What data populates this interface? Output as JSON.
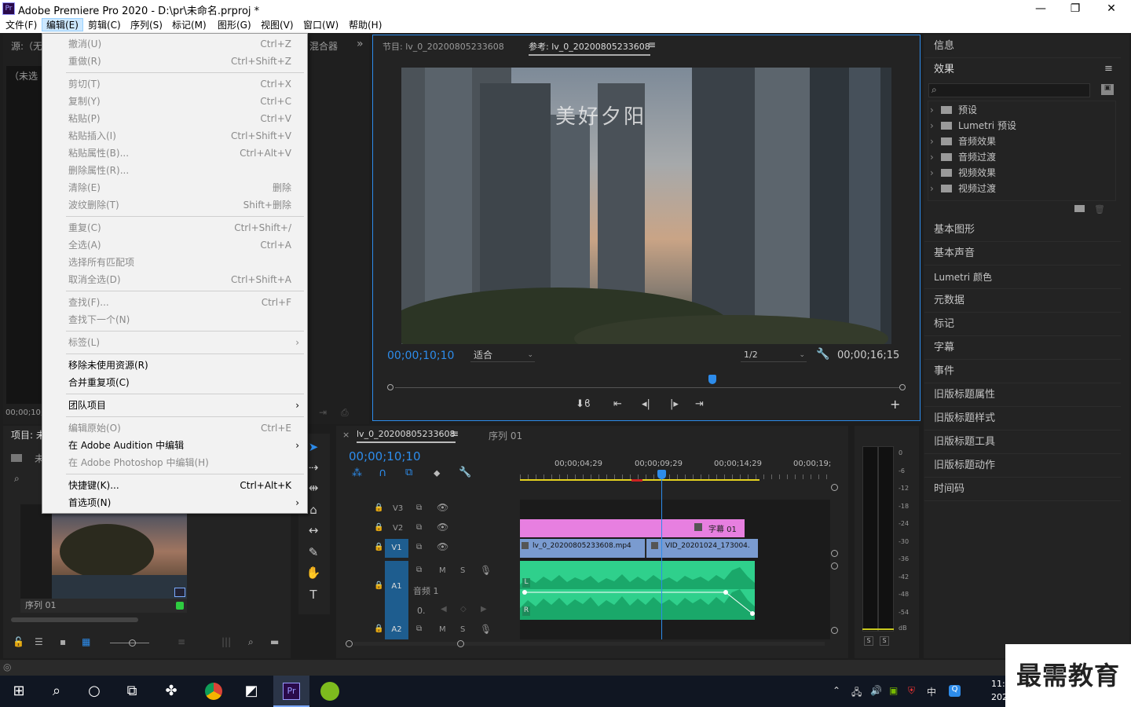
{
  "title_bar": {
    "app_icon": "Pr",
    "title": "Adobe Premiere Pro 2020 - D:\\pr\\未命名.prproj *",
    "minimize": "—",
    "maximize": "❐",
    "close": "✕"
  },
  "menu_bar": {
    "items": [
      "文件(F)",
      "编辑(E)",
      "剪辑(C)",
      "序列(S)",
      "标记(M)",
      "图形(G)",
      "视图(V)",
      "窗口(W)",
      "帮助(H)"
    ],
    "active_item": "编辑(E)"
  },
  "edit_menu": {
    "items": [
      {
        "label": "撤消(U)",
        "shortcut": "Ctrl+Z",
        "disabled": true
      },
      {
        "label": "重做(R)",
        "shortcut": "Ctrl+Shift+Z",
        "disabled": true
      },
      {
        "label": "剪切(T)",
        "shortcut": "Ctrl+X",
        "disabled": true
      },
      {
        "label": "复制(Y)",
        "shortcut": "Ctrl+C",
        "disabled": true
      },
      {
        "label": "粘贴(P)",
        "shortcut": "Ctrl+V",
        "disabled": true
      },
      {
        "label": "粘贴插入(I)",
        "shortcut": "Ctrl+Shift+V",
        "disabled": true
      },
      {
        "label": "粘贴属性(B)...",
        "shortcut": "Ctrl+Alt+V",
        "disabled": true
      },
      {
        "label": "删除属性(R)...",
        "shortcut": "",
        "disabled": true
      },
      {
        "label": "清除(E)",
        "shortcut": "删除",
        "disabled": true
      },
      {
        "label": "波纹删除(T)",
        "shortcut": "Shift+删除",
        "disabled": true
      },
      {
        "label": "重复(C)",
        "shortcut": "Ctrl+Shift+/",
        "disabled": true
      },
      {
        "label": "全选(A)",
        "shortcut": "Ctrl+A",
        "disabled": true
      },
      {
        "label": "选择所有匹配项",
        "shortcut": "",
        "disabled": true
      },
      {
        "label": "取消全选(D)",
        "shortcut": "Ctrl+Shift+A",
        "disabled": true
      },
      {
        "label": "查找(F)...",
        "shortcut": "Ctrl+F",
        "disabled": true
      },
      {
        "label": "查找下一个(N)",
        "shortcut": "",
        "disabled": true
      },
      {
        "label": "标签(L)",
        "shortcut": "",
        "disabled": true,
        "submenu": true
      },
      {
        "label": "移除未使用资源(R)",
        "shortcut": "",
        "disabled": false
      },
      {
        "label": "合并重复项(C)",
        "shortcut": "",
        "disabled": false
      },
      {
        "label": "团队项目",
        "shortcut": "",
        "disabled": false,
        "submenu": true
      },
      {
        "label": "编辑原始(O)",
        "shortcut": "Ctrl+E",
        "disabled": true
      },
      {
        "label": "在 Adobe Audition 中编辑",
        "shortcut": "",
        "disabled": false,
        "submenu": true
      },
      {
        "label": "在 Adobe Photoshop 中编辑(H)",
        "shortcut": "",
        "disabled": true
      },
      {
        "label": "快捷键(K)...",
        "shortcut": "Ctrl+Alt+K",
        "disabled": false
      },
      {
        "label": "首选项(N)",
        "shortcut": "",
        "disabled": false,
        "submenu": true
      }
    ],
    "submenu_arrow": "›"
  },
  "source_panel": {
    "tab_fragment": "源:（无",
    "audio_mixer_tab": "混合器",
    "more": "»",
    "no_clip_fragment": "（未选",
    "timecode_fragment": "00;00;10;"
  },
  "program_monitor": {
    "tab_program": "节目: lv_0_20200805233608",
    "tab_reference": "参考: lv_0_20200805233608",
    "tab_menu": "≡",
    "video_overlay_text": "美好夕阳",
    "current_timecode": "00;00;10;10",
    "fit_label": "适合",
    "resolution": "1/2",
    "duration": "00;00;16;15",
    "playhead_progress": 0.63,
    "add_button": "+"
  },
  "project_panel": {
    "tab_fragment": "项目: 未",
    "name_fragment": "未",
    "sequence_label": "序列 01"
  },
  "timeline": {
    "tab_close": "×",
    "tab_active": "lv_0_20200805233608",
    "tab_menu": "≡",
    "tab_other": "序列 01",
    "timecode": "00;00;10;10",
    "ruler_labels": [
      "00;00;04;29",
      "00;00;09;29",
      "00;00;14;29",
      "00;00;19;"
    ],
    "tracks": [
      "V3",
      "V2",
      "V1",
      "A1",
      "A2"
    ],
    "a1_name": "音频 1",
    "track_buttons": {
      "mute": "M",
      "solo": "S"
    },
    "title_clip": "字幕 01",
    "clip_1": "lv_0_20200805233608.mp4",
    "clip_2": "VID_20201024_173004.",
    "audio_channel_left": "L",
    "audio_channel_right": "R",
    "a1_volume": "0."
  },
  "audio_meter": {
    "db_labels": [
      "0",
      "-6",
      "-12",
      "-18",
      "-24",
      "-30",
      "-36",
      "-42",
      "-48",
      "-54",
      "dB"
    ],
    "solo_buttons": [
      "S",
      "S"
    ]
  },
  "right_panels": {
    "info": "信息",
    "effects_title": "效果",
    "effects_menu": "≡",
    "effects_tree": [
      "预设",
      "Lumetri 预设",
      "音频效果",
      "音频过渡",
      "视频效果",
      "视频过渡"
    ],
    "panels": [
      "基本图形",
      "基本声音",
      "Lumetri 颜色",
      "元数据",
      "标记",
      "字幕",
      "事件",
      "旧版标题属性",
      "旧版标题样式",
      "旧版标题工具",
      "旧版标题动作",
      "时间码"
    ]
  },
  "taskbar": {
    "ime_label": "中",
    "clock_fragment": "11:",
    "date_fragment": "202",
    "premiere_icon": "Pr"
  },
  "watermark": "最需教育",
  "colors": {
    "accent_blue": "#2d8ceb",
    "title_clip": "#e77fe0",
    "video_clip": "#7a9bd0",
    "audio_clip": "#2fd08c",
    "menu_bg": "#f2f2f2",
    "panel_bg": "#232323"
  }
}
